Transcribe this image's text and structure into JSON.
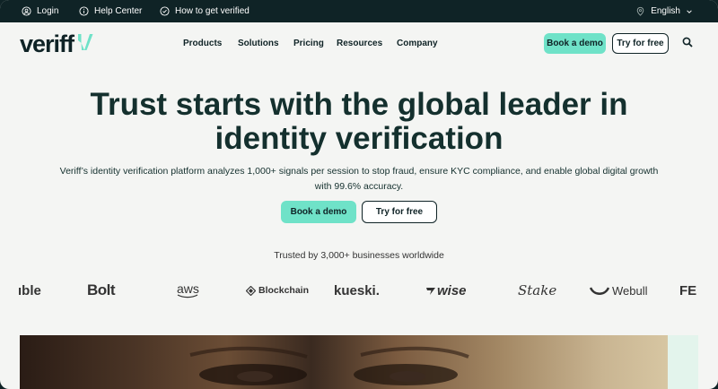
{
  "topbar": {
    "login": "Login",
    "help": "Help Center",
    "verify": "How to get verified",
    "language": "English"
  },
  "nav": {
    "logo": "veriff",
    "items": [
      "Products",
      "Solutions",
      "Pricing",
      "Resources",
      "Company"
    ],
    "book_demo": "Book a demo",
    "try_free": "Try for free"
  },
  "hero": {
    "title_line1": "Trust starts with the global leader in",
    "title_line2": "identity verification",
    "subtitle_line1": "Veriff’s identity verification platform analyzes 1,000+ signals per session to stop fraud, ensure KYC compliance, and enable global digital growth",
    "subtitle_line2": "with 99.6% accuracy.",
    "book_demo": "Book a demo",
    "try_free": "Try for free"
  },
  "trust": {
    "text": "Trusted by 3,000+ businesses worldwide",
    "logos": [
      "ıble",
      "Bolt",
      "aws",
      "Blockchain",
      "kueski.",
      "wise",
      "Stake",
      "Webull",
      "FE"
    ]
  },
  "colors": {
    "dark": "#0f2326",
    "accent": "#6fe2c8",
    "background": "#f4f5f3"
  }
}
